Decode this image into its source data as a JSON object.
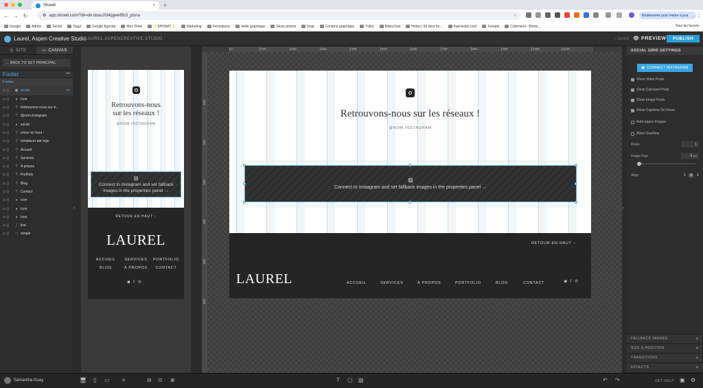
{
  "browser": {
    "tab_title": "Showit",
    "tab_close": "×",
    "new_tab": "+",
    "url": "app.showit.com/?dk=dk:obas20l4qgwel5b3_ptsna",
    "restart_label": "Redémarrer pour mettre à jour",
    "all_bookmarks": "Tous les favoris",
    "bookmarks": [
      "Google",
      "Admin",
      "Social",
      "Toggl",
      "Google Agenda",
      "Mon Drive",
      "✨SHOWIT✨",
      "Marketing",
      "Formations",
      "Veille graphique",
      "Stock photos",
      "Inspi",
      "Contenu graphique",
      "Tutos",
      "ManyChat",
      "Home | 65 best fre...",
      "mail-tester.com",
      "Freepik",
      "Colormind - Boots..."
    ],
    "colors": {
      "close": "#ff5f57",
      "minimize": "#febc2e",
      "zoom": "#28c840"
    }
  },
  "app": {
    "site_name": "Laurel, Aspen Creative Studio",
    "domain": "LAUREL.ASPENCREATIVE.STUDIO",
    "saved": "✓ SAVED",
    "preview": "PREVIEW",
    "publish": "PUBLISH"
  },
  "left_panel": {
    "tab_site": "SITE",
    "tab_canvas": "CANVAS",
    "back_button": "← BACK TO SET PRINCIPAL",
    "section": "Footer",
    "more": "•••",
    "layers": [
      {
        "label": "Footer",
        "type": "",
        "state": "selected"
      },
      {
        "label": "social",
        "type": "img",
        "state": "sub"
      },
      {
        "label": "Icon",
        "type": "icon",
        "state": ""
      },
      {
        "label": "Retrouvons-nous sur le...",
        "type": "text",
        "state": ""
      },
      {
        "label": "@nom.instagram",
        "type": "text",
        "state": ""
      },
      {
        "label": "social",
        "type": "icon",
        "state": ""
      },
      {
        "label": "retour en haut ↑",
        "type": "text",
        "state": ""
      },
      {
        "label": "remplacer par logo",
        "type": "text",
        "state": ""
      },
      {
        "label": "Accueil",
        "type": "text",
        "state": ""
      },
      {
        "label": "Services",
        "type": "text",
        "state": ""
      },
      {
        "label": "À propos",
        "type": "text",
        "state": ""
      },
      {
        "label": "Portfolio",
        "type": "text",
        "state": ""
      },
      {
        "label": "Blog",
        "type": "text",
        "state": ""
      },
      {
        "label": "Contact",
        "type": "text",
        "state": ""
      },
      {
        "label": "Icon",
        "type": "icon",
        "state": ""
      },
      {
        "label": "Icon",
        "type": "icon",
        "state": ""
      },
      {
        "label": "Icon",
        "type": "icon",
        "state": ""
      },
      {
        "label": "line",
        "type": "line",
        "state": ""
      },
      {
        "label": "simple",
        "type": "box",
        "state": ""
      }
    ]
  },
  "canvas": {
    "heading": "Retrouvons-nous sur les réseaux !",
    "heading_line1": "Retrouvons-nous",
    "heading_line2": "sur les réseaux !",
    "instagram_handle": "@NOM.INSTAGRAM",
    "fallback_text": "Connect to Instagram and set fallback images in the properties panel →",
    "fallback_line1": "Connect to Instagram and set fallback",
    "fallback_line2": "images in the properties panel →",
    "back_to_top": "RETOUR EN HAUT ↑",
    "logo": "LAUREL",
    "nav": [
      "ACCUEIL",
      "SERVICES",
      "À PROPOS",
      "PORTFOLIO",
      "BLOG",
      "CONTACT"
    ],
    "ruler_h": [
      "0",
      "100",
      "200",
      "300",
      "400",
      "500",
      "600",
      "700",
      "800",
      "900",
      "1000",
      "1100"
    ],
    "ruler_v": [
      "100",
      "200",
      "300",
      "400",
      "500",
      "600"
    ]
  },
  "right_panel": {
    "title": "SOCIAL GRID SETTINGS",
    "connect": "CONNECT INSTAGRAM",
    "options": [
      {
        "label": "Show Video Posts",
        "checked": true
      },
      {
        "label": "Show Carousel Posts",
        "checked": true
      },
      {
        "label": "Show Image Posts",
        "checked": true
      },
      {
        "label": "Show Captions On Hover",
        "checked": true
      },
      {
        "label": "Auto-space Images",
        "checked": false
      },
      {
        "label": "Allow Overflow",
        "checked": false
      }
    ],
    "rows_label": "Rows",
    "rows_value": "1",
    "gap_label": "Image Gap",
    "gap_value": "5",
    "gap_unit": "px",
    "align_label": "Align",
    "accordions": [
      "FALLBACK IMAGES",
      "SIZE & POSITION",
      "TRANSITIONS",
      "EFFECTS"
    ]
  },
  "bottom_bar": {
    "user": "Samantha Guay",
    "get_help": "GET HELP"
  }
}
